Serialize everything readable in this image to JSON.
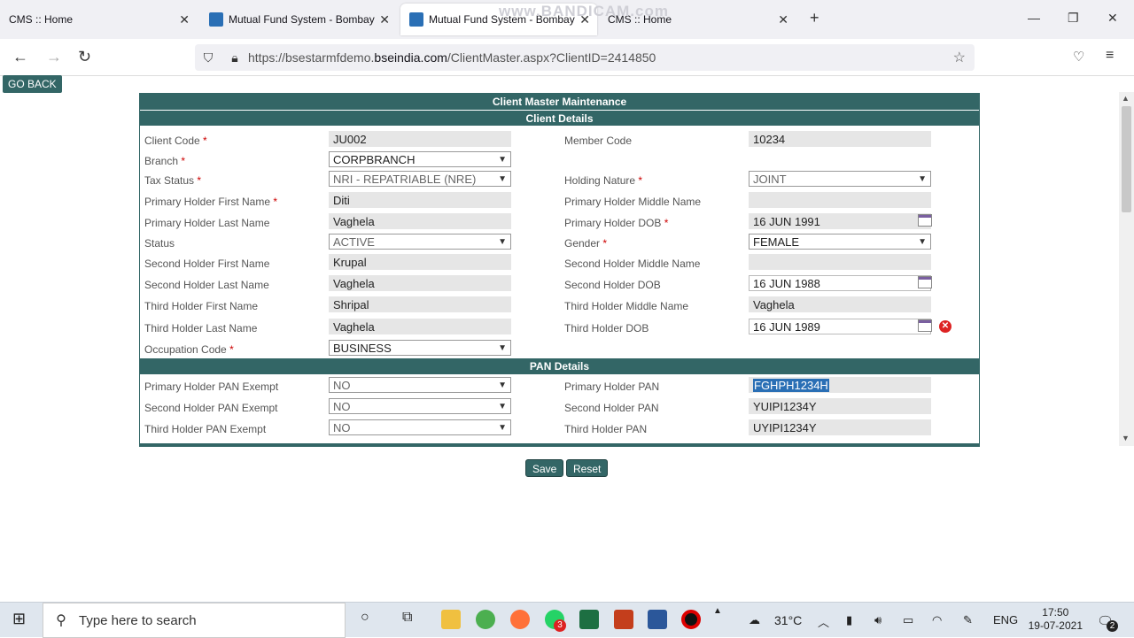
{
  "browser": {
    "tabs": [
      {
        "label": "CMS :: Home",
        "active": false
      },
      {
        "label": "Mutual Fund System - Bombay",
        "active": false
      },
      {
        "label": "Mutual Fund System - Bombay",
        "active": true
      },
      {
        "label": "CMS :: Home",
        "active": false
      }
    ],
    "url_prefix": "https://bsestarmfdemo.",
    "url_host": "bseindia.com",
    "url_path": "/ClientMaster.aspx?ClientID=2414850",
    "watermark": "www.BANDICAM.com"
  },
  "page": {
    "go_back": "GO BACK",
    "title": "Client Master Maintenance",
    "client_section": "Client Details",
    "pan_section": "PAN Details",
    "save": "Save",
    "reset": "Reset"
  },
  "client": {
    "client_code_label": "Client Code",
    "client_code": "JU002",
    "member_code_label": "Member Code",
    "member_code": "10234",
    "branch_label": "Branch",
    "branch": "CORPBRANCH",
    "tax_status_label": "Tax Status",
    "tax_status": "NRI - REPATRIABLE (NRE)",
    "holding_nature_label": "Holding Nature",
    "holding_nature": "JOINT",
    "p_first_label": "Primary Holder First Name",
    "p_first": "Diti",
    "p_middle_label": "Primary Holder Middle Name",
    "p_middle": "",
    "p_last_label": "Primary Holder Last Name",
    "p_last": "Vaghela",
    "p_dob_label": "Primary Holder DOB",
    "p_dob": "16 JUN 1991",
    "status_label": "Status",
    "status": "ACTIVE",
    "gender_label": "Gender",
    "gender": "FEMALE",
    "s_first_label": "Second Holder First Name",
    "s_first": "Krupal",
    "s_middle_label": "Second Holder Middle Name",
    "s_middle": "",
    "s_last_label": "Second Holder Last Name",
    "s_last": "Vaghela",
    "s_dob_label": "Second Holder DOB",
    "s_dob": "16 JUN 1988",
    "t_first_label": "Third Holder First Name",
    "t_first": "Shripal",
    "t_middle_label": "Third Holder Middle Name",
    "t_middle": "Vaghela",
    "t_last_label": "Third Holder Last Name",
    "t_last": "Vaghela",
    "t_dob_label": "Third Holder DOB",
    "t_dob": "16 JUN 1989",
    "occupation_label": "Occupation Code",
    "occupation": "BUSINESS"
  },
  "pan": {
    "p_exempt_label": "Primary Holder PAN Exempt",
    "p_exempt": "NO",
    "p_pan_label": "Primary Holder PAN",
    "p_pan": "FGHPH1234H",
    "s_exempt_label": "Second Holder PAN Exempt",
    "s_exempt": "NO",
    "s_pan_label": "Second Holder PAN",
    "s_pan": "YUIPI1234Y",
    "t_exempt_label": "Third Holder PAN Exempt",
    "t_exempt": "NO",
    "t_pan_label": "Third Holder PAN",
    "t_pan": "UYIPI1234Y"
  },
  "taskbar": {
    "search_placeholder": "Type here to search",
    "temperature": "31°C",
    "language": "ENG",
    "time": "17:50",
    "date": "19-07-2021",
    "whatsapp_badge": "3",
    "notif_badge": "2"
  },
  "colors": {
    "header_band": "#336666",
    "required": "#cc0000",
    "selection": "#2a6fb5"
  }
}
